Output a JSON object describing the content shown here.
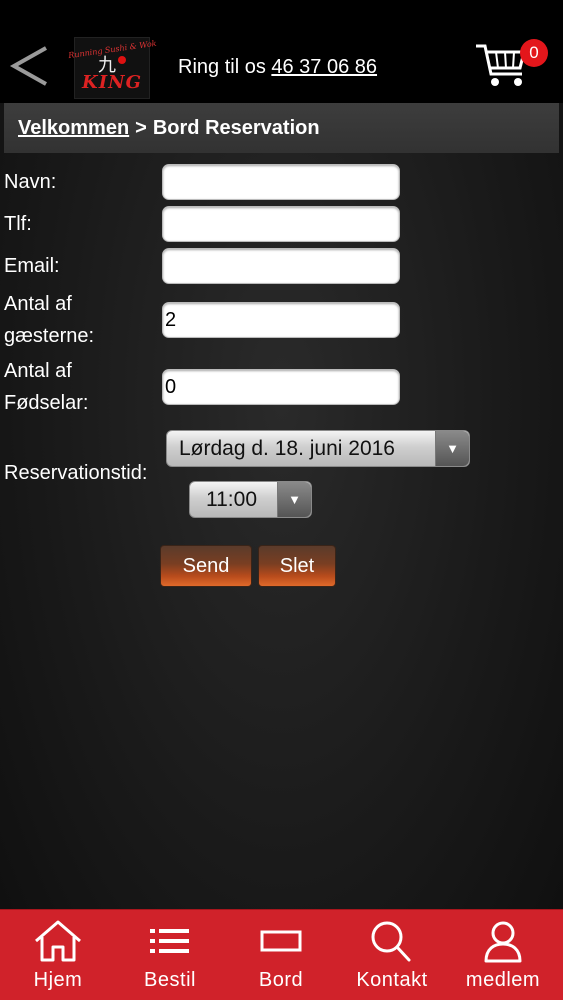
{
  "header": {
    "phone_prefix": "Ring til os",
    "phone_number": "46 37 06 86",
    "cart_count": "0",
    "logo": {
      "small_text": "Running Sushi & Wok",
      "big_text": "KING"
    }
  },
  "breadcrumb": {
    "home_label": "Velkommen",
    "separator": ">",
    "current": "Bord Reservation"
  },
  "form": {
    "name_label": "Navn:",
    "name_value": "",
    "phone_label": "Tlf:",
    "phone_value": "",
    "email_label": "Email:",
    "email_value": "",
    "guests_label_line1": "Antal af",
    "guests_label_line2": "gæsterne:",
    "guests_value": "2",
    "highchairs_label_line1": "Antal af",
    "highchairs_label_line2": "Fødselar:",
    "highchairs_value": "0",
    "time_label": "Reservationstid:",
    "date_selected": "Lørdag d. 18. juni 2016",
    "time_selected": "11:00",
    "send_label": "Send",
    "clear_label": "Slet"
  },
  "nav": {
    "items": [
      {
        "label": "Hjem",
        "icon": "home-icon"
      },
      {
        "label": "Bestil",
        "icon": "list-icon"
      },
      {
        "label": "Bord",
        "icon": "table-icon"
      },
      {
        "label": "Kontakt",
        "icon": "search-icon"
      },
      {
        "label": "medlem",
        "icon": "user-icon"
      }
    ]
  },
  "colors": {
    "nav_background": "#d0222a",
    "badge": "#e3161b",
    "button_accent": "#e06a2a"
  }
}
